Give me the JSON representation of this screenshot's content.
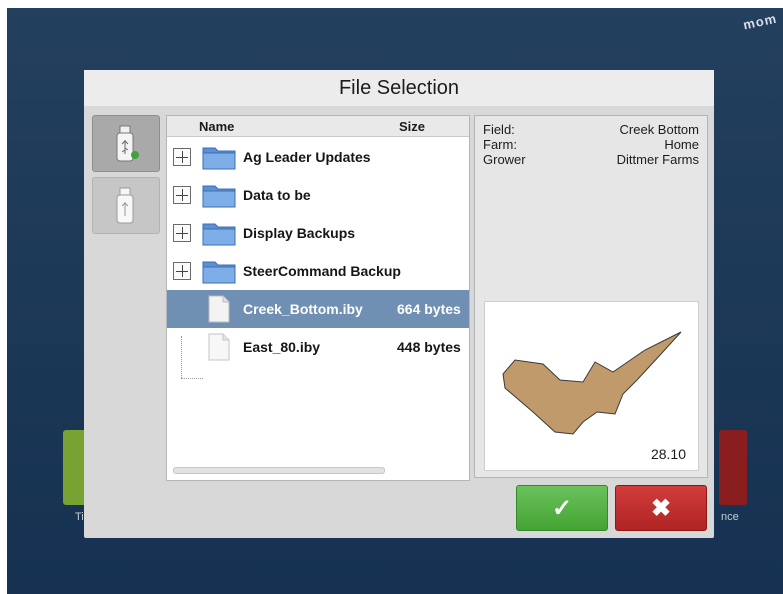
{
  "status_bar": {
    "brand_text": "mom"
  },
  "background_tiles": {
    "left_label": "Ti",
    "right_label": "nce"
  },
  "dialog": {
    "title": "File Selection",
    "devices": [
      {
        "icon": "usb-drive-icon",
        "state": "active"
      },
      {
        "icon": "usb-drive-icon",
        "state": "inactive"
      }
    ],
    "file_list": {
      "columns": {
        "name": "Name",
        "size": "Size"
      },
      "items": [
        {
          "type": "folder",
          "name": "Ag Leader Updates",
          "size": "",
          "expandable": true,
          "selected": false
        },
        {
          "type": "folder",
          "name": "Data to be",
          "size": "",
          "expandable": true,
          "selected": false
        },
        {
          "type": "folder",
          "name": "Display Backups",
          "size": "",
          "expandable": true,
          "selected": false
        },
        {
          "type": "folder",
          "name": "SteerCommand Backup",
          "size": "",
          "expandable": true,
          "selected": false
        },
        {
          "type": "file",
          "name": "Creek_Bottom.iby",
          "size": "664 bytes",
          "expandable": false,
          "selected": true
        },
        {
          "type": "file",
          "name": "East_80.iby",
          "size": "448 bytes",
          "expandable": false,
          "selected": false
        }
      ]
    },
    "details": {
      "field_label": "Field:",
      "field_value": "Creek Bottom",
      "farm_label": "Farm:",
      "farm_value": "Home",
      "grower_label": "Grower",
      "grower_value": "Dittmer Farms",
      "preview_area": "28.10"
    },
    "buttons": {
      "ok_icon": "✓",
      "cancel_icon": "✖"
    }
  },
  "colors": {
    "selected_row": "#6f8fb3",
    "ok": "#4aa83a",
    "cancel": "#b92b2b",
    "field_shape": "#c19a6b"
  }
}
